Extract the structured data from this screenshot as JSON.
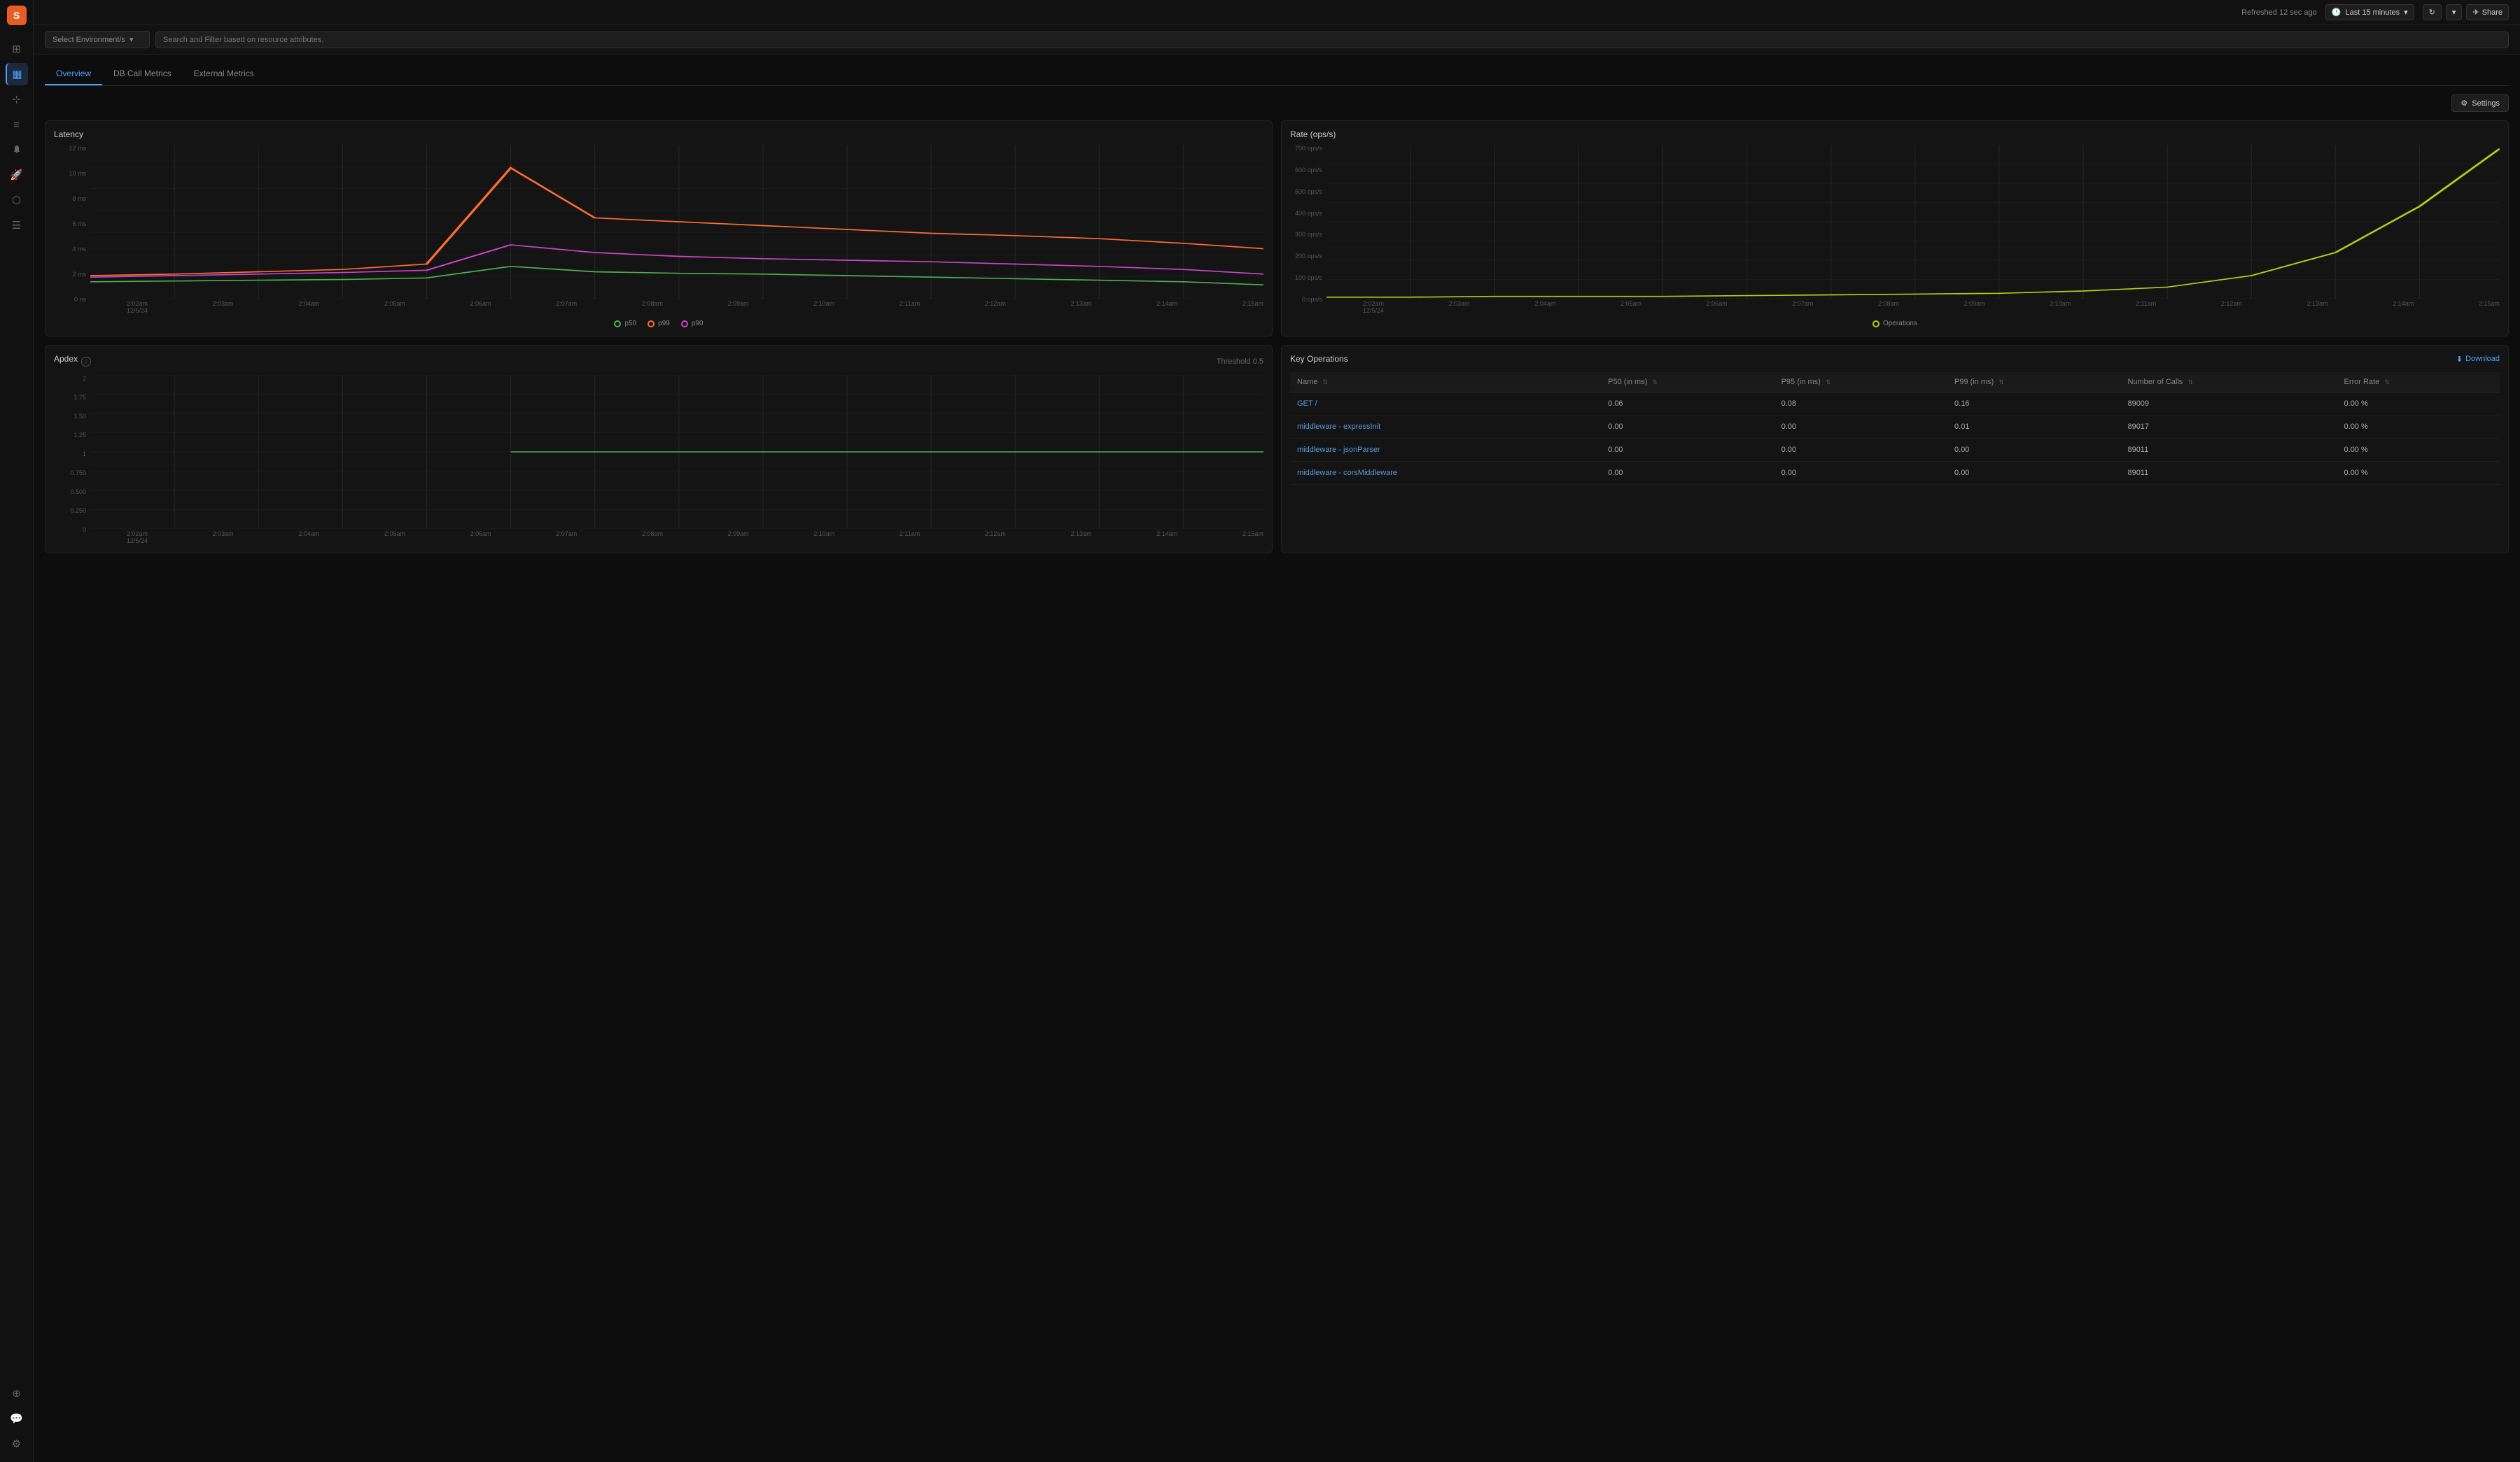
{
  "app": {
    "logo": "S"
  },
  "sidebar": {
    "icons": [
      {
        "name": "nav-dashboard",
        "symbol": "⊞",
        "active": false
      },
      {
        "name": "nav-metrics",
        "symbol": "▦",
        "active": true
      },
      {
        "name": "nav-traces",
        "symbol": "⊹",
        "active": false
      },
      {
        "name": "nav-logs",
        "symbol": "≡",
        "active": false
      },
      {
        "name": "nav-alerts",
        "symbol": "🔔",
        "active": false
      },
      {
        "name": "nav-deploy",
        "symbol": "🚀",
        "active": false
      },
      {
        "name": "nav-tests",
        "symbol": "⬡",
        "active": false
      },
      {
        "name": "nav-list",
        "symbol": "☰",
        "active": false
      },
      {
        "name": "nav-settings2",
        "symbol": "⚙",
        "active": false
      },
      {
        "name": "nav-integrations",
        "symbol": "⬡",
        "active": false
      }
    ],
    "bottom_icons": [
      {
        "name": "nav-workspace",
        "symbol": "⊕"
      },
      {
        "name": "nav-chat",
        "symbol": "💬"
      },
      {
        "name": "nav-help",
        "symbol": "?"
      }
    ]
  },
  "topbar": {
    "refresh_text": "Refreshed 12 sec ago",
    "time_selector": "Last 15 minutes",
    "refresh_icon": "↻",
    "chevron_down": "▾",
    "share_label": "Share"
  },
  "filterbar": {
    "env_placeholder": "Select Environment/s",
    "search_placeholder": "Search and Filter based on resource attributes."
  },
  "tabs": [
    {
      "label": "Overview",
      "active": true
    },
    {
      "label": "DB Call Metrics",
      "active": false
    },
    {
      "label": "External Metrics",
      "active": false
    }
  ],
  "settings_button": "Settings",
  "latency_chart": {
    "title": "Latency",
    "y_labels": [
      "12 ms",
      "10 ms",
      "8 ms",
      "6 ms",
      "4 ms",
      "2 ms",
      "0 ns"
    ],
    "x_labels": [
      "2:02am\n12/5/24",
      "2:03am",
      "2:04am",
      "2:05am",
      "2:06am",
      "2:07am",
      "2:08am",
      "2:09am",
      "2:10am",
      "2:11am",
      "2:12am",
      "2:13am",
      "2:14am",
      "2:15am"
    ],
    "legend": [
      {
        "label": "p50",
        "color": "#4CAF50"
      },
      {
        "label": "p99",
        "color": "#FF6B35"
      },
      {
        "label": "p90",
        "color": "#CC44CC"
      }
    ]
  },
  "rate_chart": {
    "title": "Rate (ops/s)",
    "y_labels": [
      "700 ops/s",
      "600 ops/s",
      "500 ops/s",
      "400 ops/s",
      "300 ops/s",
      "200 ops/s",
      "100 ops/s",
      "0 ops/s"
    ],
    "x_labels": [
      "2:02am\n12/5/24",
      "2:03am",
      "2:04am",
      "2:05am",
      "2:06am",
      "2:07am",
      "2:08am",
      "2:09am",
      "2:10am",
      "2:11am",
      "2:12am",
      "2:13am",
      "2:14am",
      "2:15am"
    ],
    "legend": [
      {
        "label": "Operations",
        "color": "#b5cc18"
      }
    ]
  },
  "apdex_chart": {
    "title": "Apdex",
    "threshold_label": "Threshold 0.5",
    "y_labels": [
      "2",
      "1.75",
      "1.50",
      "1.25",
      "1",
      "0.750",
      "0.500",
      "0.250",
      "0"
    ],
    "x_labels": [
      "2:02am\n12/5/24",
      "2:03am",
      "2:04am",
      "2:05am",
      "2:06am",
      "2:07am",
      "2:08am",
      "2:09am",
      "2:10am",
      "2:11am",
      "2:12am",
      "2:13am",
      "2:14am",
      "2:15am"
    ]
  },
  "key_operations": {
    "title": "Key Operations",
    "download_label": "Download",
    "columns": [
      {
        "label": "Name",
        "key": "name"
      },
      {
        "label": "P50 (in ms)",
        "key": "p50"
      },
      {
        "label": "P95 (in ms)",
        "key": "p95"
      },
      {
        "label": "P99 (in ms)",
        "key": "p99"
      },
      {
        "label": "Number of Calls",
        "key": "calls"
      },
      {
        "label": "Error Rate",
        "key": "error_rate"
      }
    ],
    "rows": [
      {
        "name": "GET /",
        "p50": "0.06",
        "p95": "0.08",
        "p99": "0.16",
        "calls": "89009",
        "error_rate": "0.00 %"
      },
      {
        "name": "middleware - expressInit",
        "p50": "0.00",
        "p95": "0.00",
        "p99": "0.01",
        "calls": "89017",
        "error_rate": "0.00 %"
      },
      {
        "name": "middleware - jsonParser",
        "p50": "0.00",
        "p95": "0.00",
        "p99": "0.00",
        "calls": "89011",
        "error_rate": "0.00 %"
      },
      {
        "name": "middleware - corsMiddleware",
        "p50": "0.00",
        "p95": "0.00",
        "p99": "0.00",
        "calls": "89011",
        "error_rate": "0.00 %"
      }
    ]
  }
}
